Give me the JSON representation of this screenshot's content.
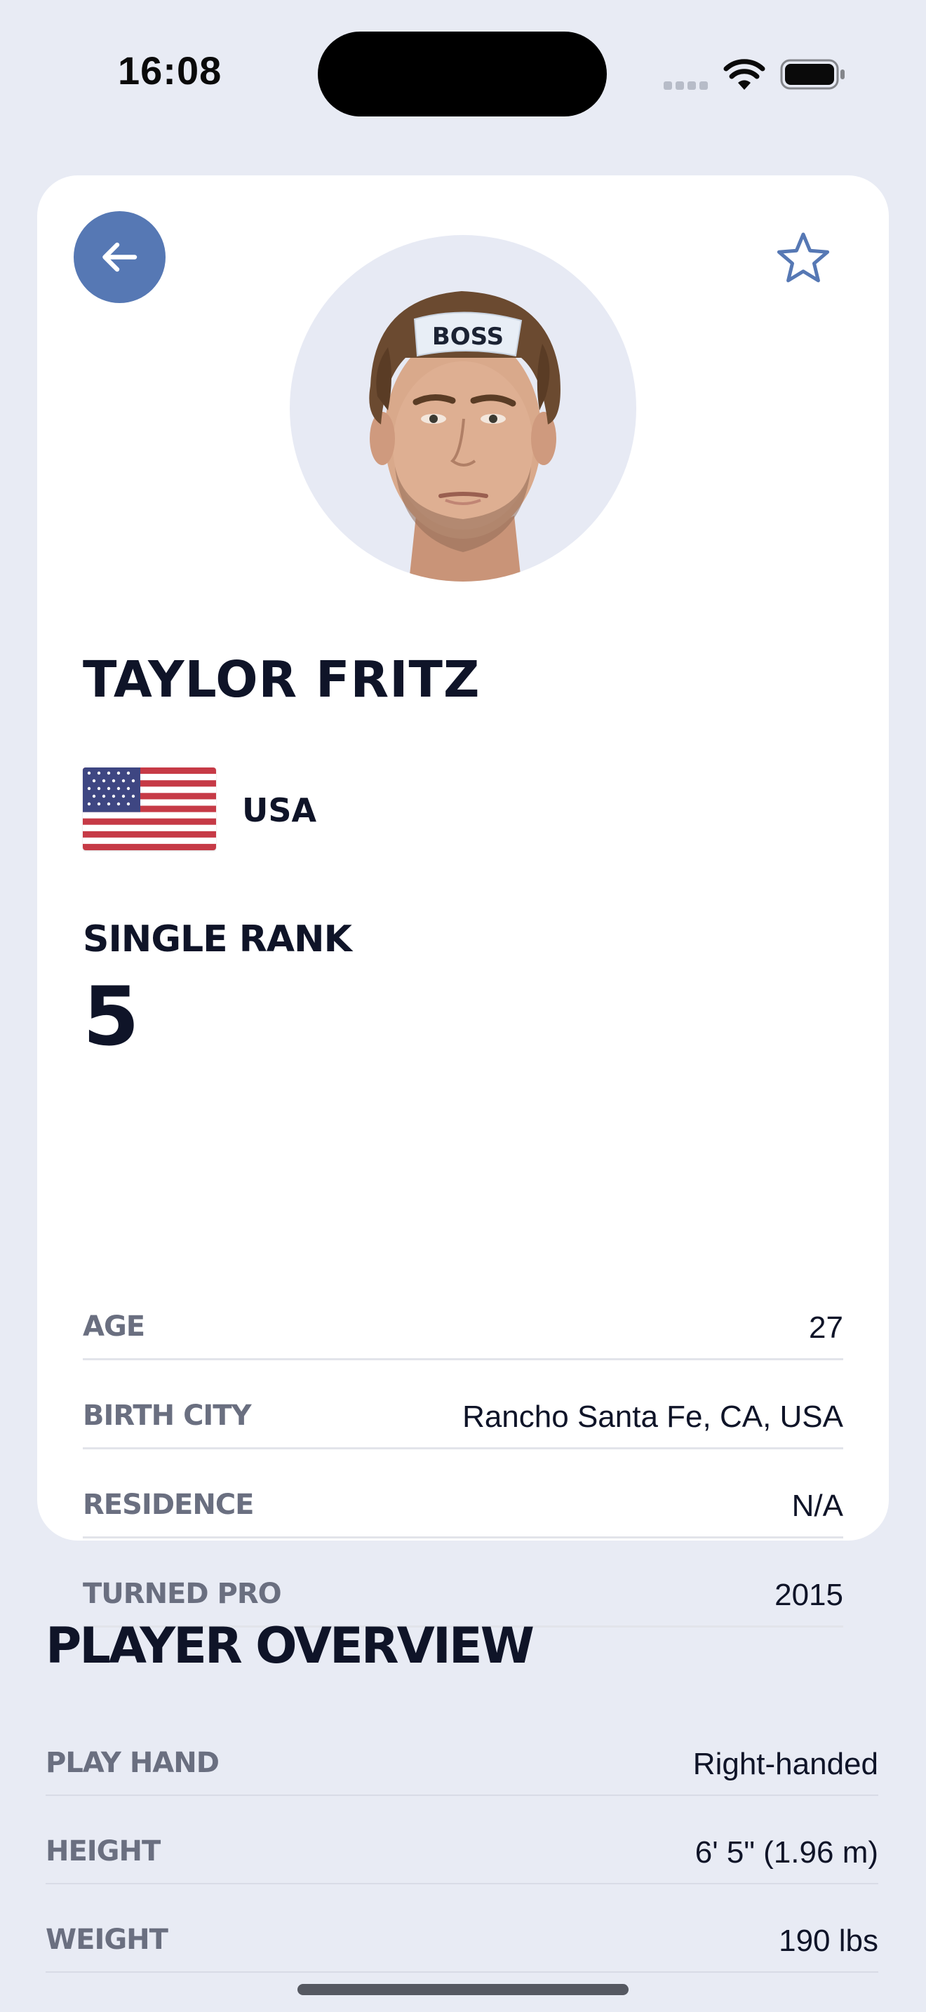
{
  "status_bar": {
    "time": "16:08"
  },
  "profile": {
    "name": "TAYLOR FRITZ",
    "country": "USA",
    "rank_label": "SINGLE RANK",
    "rank_value": "5",
    "headband_text": "BOSS",
    "details": [
      {
        "label": "AGE",
        "value": "27"
      },
      {
        "label": "BIRTH CITY",
        "value": "Rancho Santa Fe, CA, USA"
      },
      {
        "label": "RESIDENCE",
        "value": "N/A"
      },
      {
        "label": "TURNED PRO",
        "value": "2015"
      }
    ]
  },
  "overview": {
    "title": "PLAYER OVERVIEW",
    "items": [
      {
        "label": "PLAY HAND",
        "value": "Right-handed"
      },
      {
        "label": "HEIGHT",
        "value": "6' 5\" (1.96 m)"
      },
      {
        "label": "WEIGHT",
        "value": "190 lbs"
      }
    ]
  },
  "icons": {
    "back": "arrow-left-icon",
    "favorite": "star-outline-icon",
    "flag": "us-flag-icon"
  },
  "colors": {
    "background": "#e8ebf4",
    "card": "#ffffff",
    "accent": "#5678b4",
    "text_primary": "#0f1428",
    "text_secondary": "#6a6f80"
  }
}
